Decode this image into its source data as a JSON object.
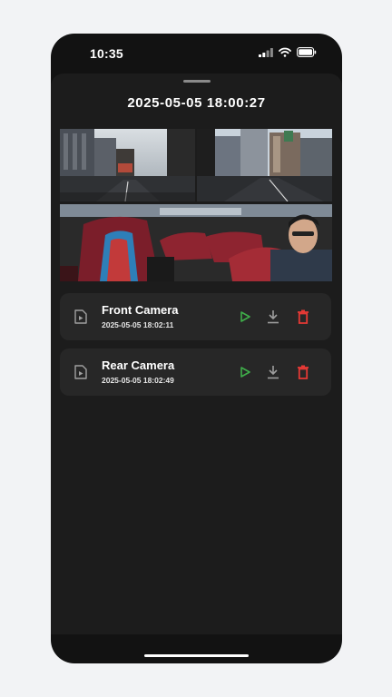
{
  "status_bar": {
    "time": "10:35"
  },
  "recording": {
    "timestamp": "2025-05-05 18:00:27"
  },
  "files": [
    {
      "name": "Front Camera",
      "date": "2025-05-05 18:02:11"
    },
    {
      "name": "Rear Camera",
      "date": "2025-05-05 18:02:49"
    }
  ],
  "icons": {
    "file": "video-file-icon",
    "play": "play-icon",
    "download": "download-icon",
    "delete": "trash-icon"
  },
  "colors": {
    "play": "#3fae4a",
    "delete": "#e53935",
    "download": "#9e9e9e",
    "sheet_bg": "#1c1c1c",
    "card_bg": "#272727"
  }
}
